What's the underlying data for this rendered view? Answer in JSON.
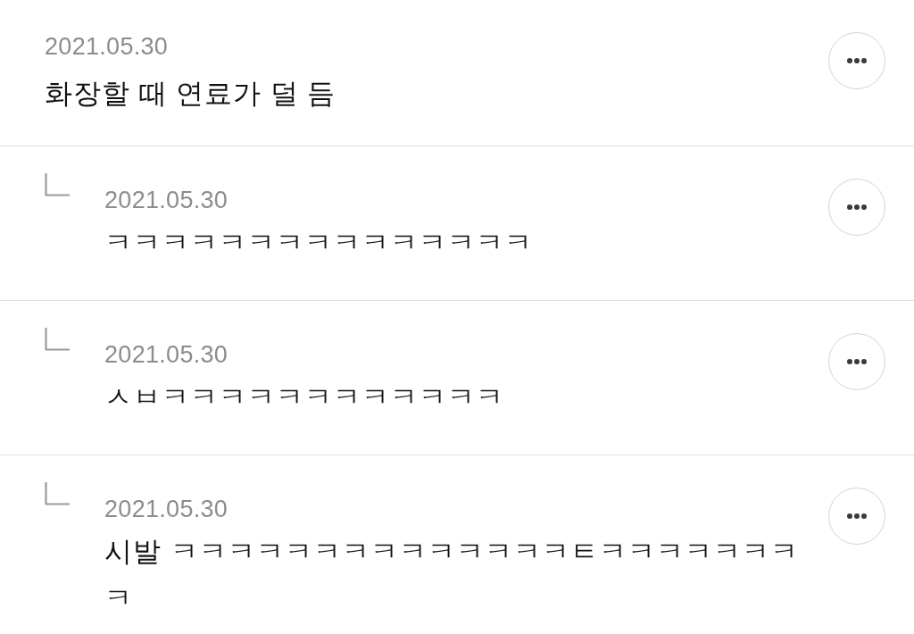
{
  "comments": [
    {
      "kind": "comment",
      "date": "2021.05.30",
      "text": "화장할 때 연료가 덜 듬"
    },
    {
      "kind": "reply",
      "date": "2021.05.30",
      "text": "ㅋㅋㅋㅋㅋㅋㅋㅋㅋㅋㅋㅋㅋㅋㅋ"
    },
    {
      "kind": "reply",
      "date": "2021.05.30",
      "text": "ㅅㅂㅋㅋㅋㅋㅋㅋㅋㅋㅋㅋㅋㅋ"
    },
    {
      "kind": "reply",
      "date": "2021.05.30",
      "text": "시발 ㅋㅋㅋㅋㅋㅋㅋㅋㅋㅋㅋㅋㅋㅋㅌㅋㅋㅋㅋㅋㅋㅋㅋ"
    }
  ]
}
